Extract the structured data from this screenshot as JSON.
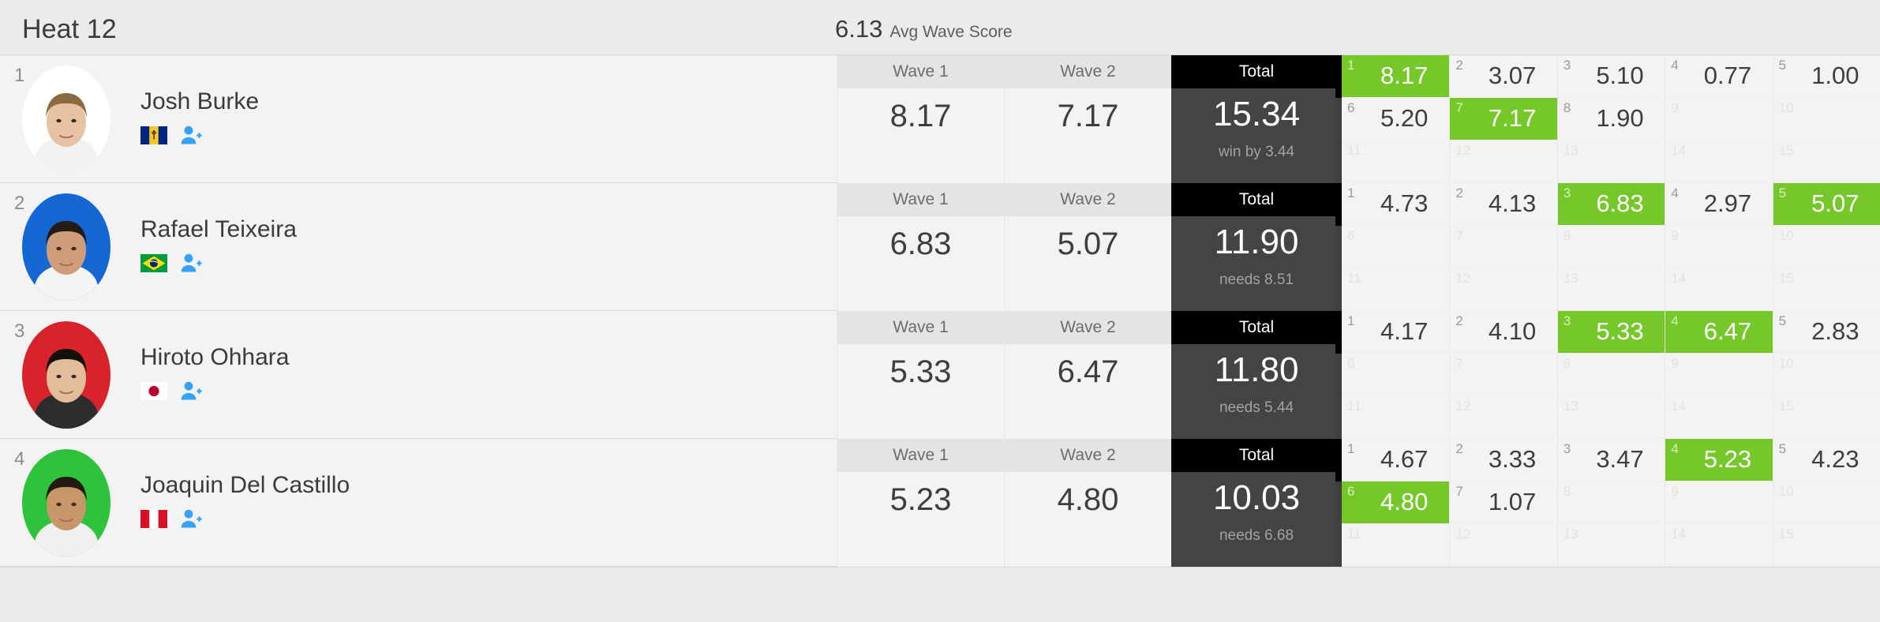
{
  "header": {
    "heat_title": "Heat 12",
    "avg_value": "6.13",
    "avg_label": "Avg Wave Score"
  },
  "columns": {
    "wave1_label": "Wave 1",
    "wave2_label": "Wave 2",
    "total_label": "Total"
  },
  "colors": {
    "scoring_green": "#76c82a",
    "total_header": "#000000",
    "total_body": "#444444",
    "page_background": "#ebebeb",
    "row_background": "#f3f3f3"
  },
  "icons": {
    "add_person": "add-person-icon"
  },
  "athletes": [
    {
      "rank": "1",
      "name": "Josh Burke",
      "country": "Barbados",
      "flag": "bb",
      "avatar_bg": "#ffffff",
      "wave1": "8.17",
      "wave2": "7.17",
      "total": "15.34",
      "total_note": "win by 3.44",
      "waves": [
        {
          "num": "1",
          "score": "8.17",
          "scoring": true
        },
        {
          "num": "2",
          "score": "3.07",
          "scoring": false
        },
        {
          "num": "3",
          "score": "5.10",
          "scoring": false
        },
        {
          "num": "4",
          "score": "0.77",
          "scoring": false
        },
        {
          "num": "5",
          "score": "1.00",
          "scoring": false
        },
        {
          "num": "6",
          "score": "5.20",
          "scoring": false
        },
        {
          "num": "7",
          "score": "7.17",
          "scoring": true
        },
        {
          "num": "8",
          "score": "1.90",
          "scoring": false
        },
        {
          "num": "9",
          "score": "",
          "scoring": false
        },
        {
          "num": "10",
          "score": "",
          "scoring": false
        },
        {
          "num": "11",
          "score": "",
          "scoring": false
        },
        {
          "num": "12",
          "score": "",
          "scoring": false
        },
        {
          "num": "13",
          "score": "",
          "scoring": false
        },
        {
          "num": "14",
          "score": "",
          "scoring": false
        },
        {
          "num": "15",
          "score": "",
          "scoring": false
        }
      ]
    },
    {
      "rank": "2",
      "name": "Rafael Teixeira",
      "country": "Brazil",
      "flag": "br",
      "avatar_bg": "#1567d3",
      "wave1": "6.83",
      "wave2": "5.07",
      "total": "11.90",
      "total_note": "needs 8.51",
      "waves": [
        {
          "num": "1",
          "score": "4.73",
          "scoring": false
        },
        {
          "num": "2",
          "score": "4.13",
          "scoring": false
        },
        {
          "num": "3",
          "score": "6.83",
          "scoring": true
        },
        {
          "num": "4",
          "score": "2.97",
          "scoring": false
        },
        {
          "num": "5",
          "score": "5.07",
          "scoring": true
        },
        {
          "num": "6",
          "score": "",
          "scoring": false
        },
        {
          "num": "7",
          "score": "",
          "scoring": false
        },
        {
          "num": "8",
          "score": "",
          "scoring": false
        },
        {
          "num": "9",
          "score": "",
          "scoring": false
        },
        {
          "num": "10",
          "score": "",
          "scoring": false
        },
        {
          "num": "11",
          "score": "",
          "scoring": false
        },
        {
          "num": "12",
          "score": "",
          "scoring": false
        },
        {
          "num": "13",
          "score": "",
          "scoring": false
        },
        {
          "num": "14",
          "score": "",
          "scoring": false
        },
        {
          "num": "15",
          "score": "",
          "scoring": false
        }
      ]
    },
    {
      "rank": "3",
      "name": "Hiroto Ohhara",
      "country": "Japan",
      "flag": "jp",
      "avatar_bg": "#d8232a",
      "wave1": "5.33",
      "wave2": "6.47",
      "total": "11.80",
      "total_note": "needs 5.44",
      "waves": [
        {
          "num": "1",
          "score": "4.17",
          "scoring": false
        },
        {
          "num": "2",
          "score": "4.10",
          "scoring": false
        },
        {
          "num": "3",
          "score": "5.33",
          "scoring": true
        },
        {
          "num": "4",
          "score": "6.47",
          "scoring": true
        },
        {
          "num": "5",
          "score": "2.83",
          "scoring": false
        },
        {
          "num": "6",
          "score": "",
          "scoring": false
        },
        {
          "num": "7",
          "score": "",
          "scoring": false
        },
        {
          "num": "8",
          "score": "",
          "scoring": false
        },
        {
          "num": "9",
          "score": "",
          "scoring": false
        },
        {
          "num": "10",
          "score": "",
          "scoring": false
        },
        {
          "num": "11",
          "score": "",
          "scoring": false
        },
        {
          "num": "12",
          "score": "",
          "scoring": false
        },
        {
          "num": "13",
          "score": "",
          "scoring": false
        },
        {
          "num": "14",
          "score": "",
          "scoring": false
        },
        {
          "num": "15",
          "score": "",
          "scoring": false
        }
      ]
    },
    {
      "rank": "4",
      "name": "Joaquin Del Castillo",
      "country": "Peru",
      "flag": "pe",
      "avatar_bg": "#2fc23c",
      "wave1": "5.23",
      "wave2": "4.80",
      "total": "10.03",
      "total_note": "needs 6.68",
      "waves": [
        {
          "num": "1",
          "score": "4.67",
          "scoring": false
        },
        {
          "num": "2",
          "score": "3.33",
          "scoring": false
        },
        {
          "num": "3",
          "score": "3.47",
          "scoring": false
        },
        {
          "num": "4",
          "score": "5.23",
          "scoring": true
        },
        {
          "num": "5",
          "score": "4.23",
          "scoring": false
        },
        {
          "num": "6",
          "score": "4.80",
          "scoring": true
        },
        {
          "num": "7",
          "score": "1.07",
          "scoring": false
        },
        {
          "num": "8",
          "score": "",
          "scoring": false
        },
        {
          "num": "9",
          "score": "",
          "scoring": false
        },
        {
          "num": "10",
          "score": "",
          "scoring": false
        },
        {
          "num": "11",
          "score": "",
          "scoring": false
        },
        {
          "num": "12",
          "score": "",
          "scoring": false
        },
        {
          "num": "13",
          "score": "",
          "scoring": false
        },
        {
          "num": "14",
          "score": "",
          "scoring": false
        },
        {
          "num": "15",
          "score": "",
          "scoring": false
        }
      ]
    }
  ]
}
